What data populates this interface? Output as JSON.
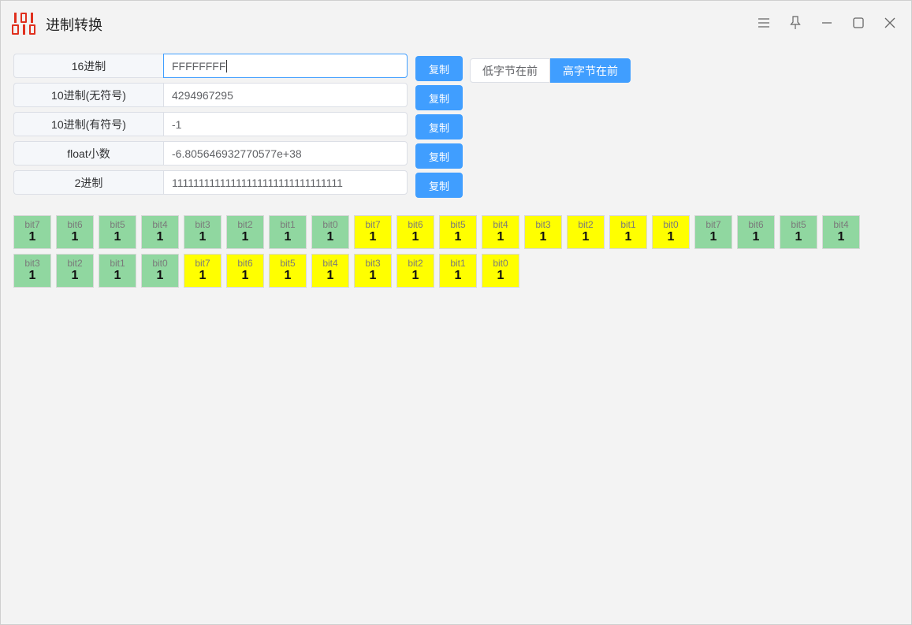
{
  "window": {
    "title": "进制转换",
    "controls": [
      "menu-icon",
      "pin-icon",
      "minimize-icon",
      "maximize-icon",
      "close-icon"
    ]
  },
  "fields": [
    {
      "label": "16进制",
      "value": "FFFFFFFF",
      "copy": "复制"
    },
    {
      "label": "10进制(无符号)",
      "value": "4294967295",
      "copy": "复制"
    },
    {
      "label": "10进制(有符号)",
      "value": "-1",
      "copy": "复制"
    },
    {
      "label": "float小数",
      "value": "-6.805646932770577e+38",
      "copy": "复制"
    },
    {
      "label": "2进制",
      "value": "11111111111111111111111111111111",
      "copy": "复制"
    }
  ],
  "byte_order": {
    "options": [
      "低字节在前",
      "高字节在前"
    ],
    "selected": "高字节在前"
  },
  "colors": {
    "accent": "#409eff",
    "byte_even": "#90d7a0",
    "byte_odd": "#ffff00"
  },
  "bytes": [
    {
      "color": "green",
      "bits": [
        {
          "label": "bit7",
          "value": "1"
        },
        {
          "label": "bit6",
          "value": "1"
        },
        {
          "label": "bit5",
          "value": "1"
        },
        {
          "label": "bit4",
          "value": "1"
        },
        {
          "label": "bit3",
          "value": "1"
        },
        {
          "label": "bit2",
          "value": "1"
        },
        {
          "label": "bit1",
          "value": "1"
        },
        {
          "label": "bit0",
          "value": "1"
        }
      ]
    },
    {
      "color": "yellow",
      "bits": [
        {
          "label": "bit7",
          "value": "1"
        },
        {
          "label": "bit6",
          "value": "1"
        },
        {
          "label": "bit5",
          "value": "1"
        },
        {
          "label": "bit4",
          "value": "1"
        },
        {
          "label": "bit3",
          "value": "1"
        },
        {
          "label": "bit2",
          "value": "1"
        },
        {
          "label": "bit1",
          "value": "1"
        },
        {
          "label": "bit0",
          "value": "1"
        }
      ]
    },
    {
      "color": "green",
      "bits": [
        {
          "label": "bit7",
          "value": "1"
        },
        {
          "label": "bit6",
          "value": "1"
        },
        {
          "label": "bit5",
          "value": "1"
        },
        {
          "label": "bit4",
          "value": "1"
        },
        {
          "label": "bit3",
          "value": "1"
        },
        {
          "label": "bit2",
          "value": "1"
        },
        {
          "label": "bit1",
          "value": "1"
        },
        {
          "label": "bit0",
          "value": "1"
        }
      ]
    },
    {
      "color": "yellow",
      "bits": [
        {
          "label": "bit7",
          "value": "1"
        },
        {
          "label": "bit6",
          "value": "1"
        },
        {
          "label": "bit5",
          "value": "1"
        },
        {
          "label": "bit4",
          "value": "1"
        },
        {
          "label": "bit3",
          "value": "1"
        },
        {
          "label": "bit2",
          "value": "1"
        },
        {
          "label": "bit1",
          "value": "1"
        },
        {
          "label": "bit0",
          "value": "1"
        }
      ]
    }
  ]
}
